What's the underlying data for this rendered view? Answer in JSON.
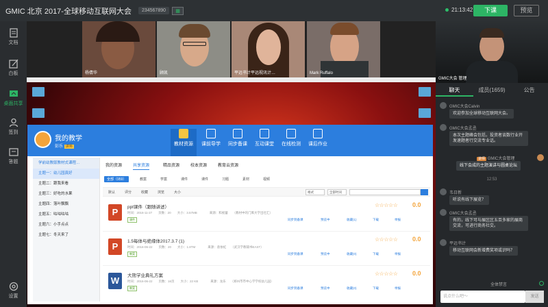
{
  "topbar": {
    "title": "GMIC 北京 2017-全球移动互联网大会",
    "room_id": "234567890",
    "timer": "21:13:42",
    "end_label": "下课",
    "preview_label": "预览"
  },
  "leftnav": [
    {
      "label": "文档",
      "icon": "document-icon"
    },
    {
      "label": "白板",
      "icon": "whiteboard-icon"
    },
    {
      "label": "桌面共享",
      "icon": "screen-share-icon"
    },
    {
      "label": "签到",
      "icon": "checkin-icon"
    },
    {
      "label": "答题",
      "icon": "quiz-icon"
    },
    {
      "label": "设置",
      "icon": "settings-icon"
    }
  ],
  "videos": [
    {
      "name": "杨倩华"
    },
    {
      "name": "顾凯"
    },
    {
      "name": "平远书计平远视讯计…"
    },
    {
      "name": "Mark Ruffalo"
    }
  ],
  "teacher_video": {
    "name": "GMIC大会 管理"
  },
  "app": {
    "title": "我的教学",
    "user": "彭乐",
    "badge": "讲师",
    "tabs": [
      "教材资源",
      "课前导学",
      "同步备课",
      "互动课堂",
      "在线检测",
      "课后作业"
    ],
    "catalog_header": "学前幼教版教材式课程…",
    "catalog": [
      "主题一：幼儿园真好",
      "主题二：跟我来看",
      "主题三：好吃的水果",
      "主题四：落叶飘飘",
      "主题五：咕咕咕咕",
      "主题六：小手点点",
      "主题七：冬天来了"
    ],
    "res_tabs": [
      "我的资源",
      "共享资源",
      "精品资源",
      "校本资源",
      "教育云资源"
    ],
    "sub_tabs": [
      "全部（959）",
      "教案",
      "学案",
      "课件",
      "课件",
      "习题",
      "素材",
      "视频"
    ],
    "sort": [
      "默认",
      "评分",
      "收藏",
      "浏览",
      "大小"
    ],
    "filters": [
      "格式",
      "全部时间"
    ],
    "resources": [
      {
        "type": "P",
        "name": "ppt课件（跟随讲述）",
        "meta": "时间：2016-11-27　　页数：20　　大小：3.57MB　　　　来源：和视蕾　　（教材中的门库大学出社汇）",
        "tag": "课件",
        "score": "0.0",
        "actions": [
          "同步到备课",
          "预览中",
          "收藏(1)",
          "下载",
          "举报"
        ]
      },
      {
        "type": "P",
        "name": "1.5每体与绝缘体2017.3.7 (1)",
        "meta": "时间：2016-06-22　　页数：20　　大小：1.8TM　　　　来源：袁依虹　　（武汉学教辅书EAST）",
        "tag": "教案",
        "score": "0.0",
        "actions": [
          "同步到备课",
          "预览中",
          "收藏(0)",
          "下载",
          "举报"
        ]
      },
      {
        "type": "W",
        "name": "大熊学业典礼方案",
        "meta": "时间：2016-06-22　　页数：16页　　大小：22 KB　　　　来源：龙乐　　（郑州市市中心学学校幼儿园）",
        "tag": "教案",
        "score": "0.0",
        "actions": [
          "同步到备课",
          "预览中",
          "收藏(0)",
          "下载",
          "举报"
        ]
      }
    ]
  },
  "chat": {
    "tabs": [
      "聊天",
      "成员(1659)",
      "公告"
    ],
    "messages": [
      {
        "user": "GMIC大会Calvin",
        "text": "欢迎参加全球移动互联网大会。"
      },
      {
        "user": "GMIC大会孟丞",
        "text": "本次主题峰会包括，投资者谈数行业开发速题者行交流专业话。"
      },
      {
        "user": "GMIC大会管理",
        "badge": "讲师",
        "text": "线下会成的主题演讲与圆桌论坛"
      },
      {
        "time": "12:53"
      },
      {
        "user": "韦日新",
        "text": "听说有线下展览？"
      },
      {
        "user": "GMIC大会孟丞",
        "text": "有的，线下可与展区区五百多家的展商交流，可进行商务社交。"
      },
      {
        "user": "平远书计",
        "text": "移动互联网会新增费奖项或识吗？"
      }
    ],
    "mute_label": "全体禁言",
    "input_placeholder": "说点什么吧～",
    "send_label": "发送"
  },
  "colors": {
    "accent": "#2db565",
    "app_blue": "#2c7ede",
    "star": "#f3a43b"
  }
}
